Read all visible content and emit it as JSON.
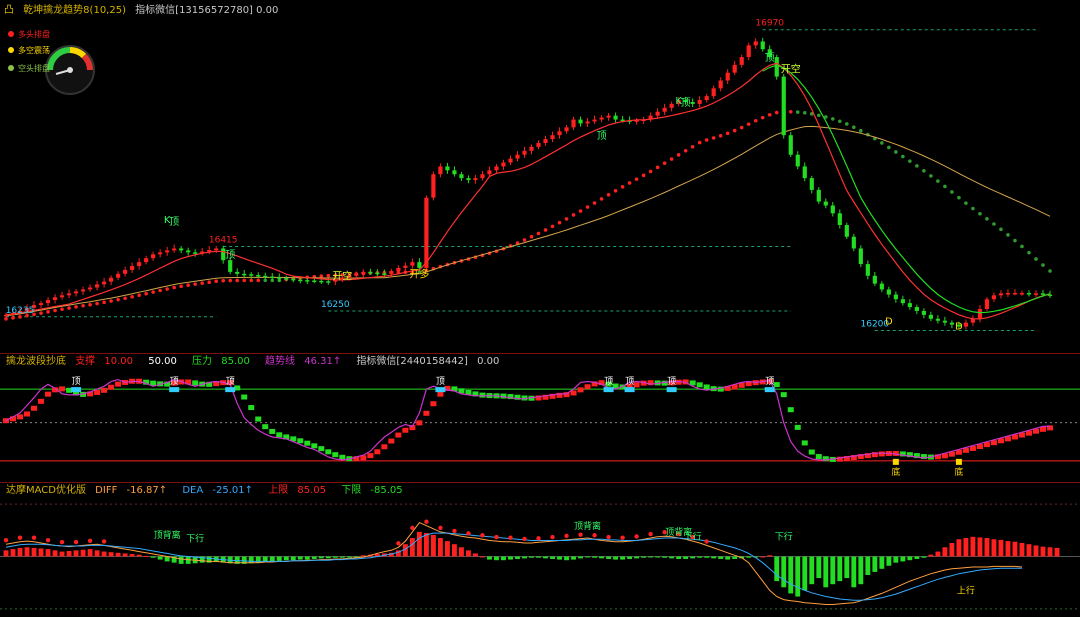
{
  "colors": {
    "up": "#ff2020",
    "down": "#22dd22",
    "bg": "#000000",
    "grid": "#7a1010",
    "gold": "#ffd700",
    "cyan": "#33ccff",
    "magenta": "#cc33cc"
  },
  "main_panel": {
    "header_prefix": "凸",
    "title": "乾坤擒龙趋势8(10,25)",
    "extra_label": "指标微信[13156572780] 0.00",
    "legend": [
      {
        "label": "多头排盘",
        "color": "#ff2020"
      },
      {
        "label": "多空震荡",
        "color": "#ffd700"
      },
      {
        "label": "空头排盘",
        "color": "#8bc34a"
      }
    ],
    "gauge_icon": "speedometer-icon",
    "price_annotations": [
      {
        "text": "16970",
        "x": 109,
        "y": 16970
      },
      {
        "text": "16415",
        "x": 31,
        "y": 16415
      },
      {
        "text": "16250",
        "x": 47,
        "y": 16250
      },
      {
        "text": "16235",
        "x": 2,
        "y": 16235
      },
      {
        "text": "16200",
        "x": 124,
        "y": 16200
      }
    ],
    "signal_labels": [
      {
        "text": "K",
        "x": 23,
        "y": 16475
      },
      {
        "text": "顶",
        "x": 24,
        "y": 16470
      },
      {
        "text": "顶",
        "x": 32,
        "y": 16385
      },
      {
        "text": "开空",
        "x": 48,
        "y": 16330
      },
      {
        "text": "开多",
        "x": 59,
        "y": 16335
      },
      {
        "text": "顶",
        "x": 85,
        "y": 16690
      },
      {
        "text": "K",
        "x": 96,
        "y": 16780
      },
      {
        "text": "顶",
        "x": 97,
        "y": 16775
      },
      {
        "text": "顶",
        "x": 109,
        "y": 16890
      },
      {
        "text": "开空",
        "x": 112,
        "y": 16860
      },
      {
        "text": "D",
        "x": 126,
        "y": 16215
      },
      {
        "text": "D",
        "x": 136,
        "y": 16202
      }
    ]
  },
  "osc_panel": {
    "title": "擒龙波段抄底",
    "items": [
      {
        "label": "支撑",
        "value": "10.00",
        "color": "#ff2020"
      },
      {
        "label": "",
        "value": "50.00",
        "color": "#ffffff"
      },
      {
        "label": "压力",
        "value": "85.00",
        "color": "#22dd22"
      },
      {
        "label": "趋势线",
        "value": "46.31↑",
        "color": "#cc33cc"
      },
      {
        "label": "指标微信[2440158442]",
        "value": "0.00",
        "color": "#cccccc"
      }
    ],
    "top_labels": [
      {
        "text": "顶",
        "x": 10
      },
      {
        "text": "顶",
        "x": 24
      },
      {
        "text": "顶",
        "x": 32
      },
      {
        "text": "顶",
        "x": 62
      },
      {
        "text": "顶",
        "x": 86
      },
      {
        "text": "顶",
        "x": 89
      },
      {
        "text": "顶",
        "x": 95
      },
      {
        "text": "顶",
        "x": 109
      }
    ],
    "bottom_labels": [
      {
        "text": "底",
        "x": 127
      },
      {
        "text": "底",
        "x": 136
      }
    ]
  },
  "macd_panel": {
    "title": "达摩MACD优化版",
    "items": [
      {
        "label": "DIFF",
        "value": "-16.87↑",
        "color": "#ffa040"
      },
      {
        "label": "DEA",
        "value": "-25.01↑",
        "color": "#33aaff"
      },
      {
        "label": "上限",
        "value": "85.05",
        "color": "#ff2020"
      },
      {
        "label": "下限",
        "value": "-85.05",
        "color": "#22dd22"
      }
    ],
    "signal_labels": [
      {
        "text": "顶背离",
        "x": 23,
        "y": 30
      },
      {
        "text": "下行",
        "x": 27,
        "y": 24
      },
      {
        "text": "顶背离",
        "x": 83,
        "y": 45
      },
      {
        "text": "顶背离",
        "x": 96,
        "y": 35
      },
      {
        "text": "下行",
        "x": 98,
        "y": 28
      },
      {
        "text": "下行",
        "x": 111,
        "y": 28
      },
      {
        "text": "上行",
        "x": 137,
        "y": -60
      }
    ]
  },
  "chart_data": {
    "type": "candlestick",
    "x": [
      0,
      1,
      2,
      3,
      4,
      5,
      6,
      7,
      8,
      9,
      10,
      11,
      12,
      13,
      14,
      15,
      16,
      17,
      18,
      19,
      20,
      21,
      22,
      23,
      24,
      25,
      26,
      27,
      28,
      29,
      30,
      31,
      32,
      33,
      34,
      35,
      36,
      37,
      38,
      39,
      40,
      41,
      42,
      43,
      44,
      45,
      46,
      47,
      48,
      49,
      50,
      51,
      52,
      53,
      54,
      55,
      56,
      57,
      58,
      59,
      60,
      61,
      62,
      63,
      64,
      65,
      66,
      67,
      68,
      69,
      70,
      71,
      72,
      73,
      74,
      75,
      76,
      77,
      78,
      79,
      80,
      81,
      82,
      83,
      84,
      85,
      86,
      87,
      88,
      89,
      90,
      91,
      92,
      93,
      94,
      95,
      96,
      97,
      98,
      99,
      100,
      101,
      102,
      103,
      104,
      105,
      106,
      107,
      108,
      109,
      110,
      111,
      112,
      113,
      114,
      115,
      116,
      117,
      118,
      119,
      120,
      121,
      122,
      123,
      124,
      125,
      126,
      127,
      128,
      129,
      130,
      131,
      132,
      133,
      134,
      135,
      136,
      137,
      138,
      139,
      140,
      141,
      142,
      143,
      144,
      145,
      146,
      147,
      148,
      149
    ],
    "close": [
      16240,
      16245,
      16250,
      16258,
      16265,
      16270,
      16278,
      16285,
      16290,
      16295,
      16300,
      16305,
      16310,
      16318,
      16325,
      16335,
      16345,
      16355,
      16365,
      16375,
      16385,
      16395,
      16400,
      16405,
      16410,
      16405,
      16400,
      16398,
      16402,
      16406,
      16410,
      16380,
      16350,
      16345,
      16344,
      16342,
      16340,
      16338,
      16336,
      16334,
      16332,
      16330,
      16329,
      16328,
      16327,
      16326,
      16325,
      16330,
      16335,
      16340,
      16345,
      16350,
      16348,
      16346,
      16345,
      16352,
      16360,
      16366,
      16375,
      16360,
      16540,
      16600,
      16620,
      16610,
      16600,
      16590,
      16585,
      16590,
      16600,
      16610,
      16620,
      16630,
      16640,
      16650,
      16660,
      16670,
      16680,
      16690,
      16700,
      16710,
      16720,
      16740,
      16730,
      16735,
      16740,
      16745,
      16750,
      16740,
      16738,
      16735,
      16738,
      16740,
      16750,
      16760,
      16770,
      16780,
      16790,
      16785,
      16780,
      16790,
      16800,
      16820,
      16840,
      16860,
      16880,
      16900,
      16930,
      16940,
      16920,
      16900,
      16850,
      16700,
      16650,
      16620,
      16590,
      16560,
      16530,
      16520,
      16500,
      16470,
      16440,
      16410,
      16370,
      16340,
      16320,
      16305,
      16292,
      16280,
      16270,
      16260,
      16250,
      16240,
      16230,
      16225,
      16220,
      16215,
      16210,
      16220,
      16230,
      16255,
      16280,
      16290,
      16295,
      16296,
      16296,
      16296,
      16295,
      16295,
      16292,
      16290
    ],
    "ylim": [
      16150,
      17000
    ],
    "osc": {
      "ylim": [
        -10,
        105
      ],
      "support": 10,
      "mid": 50,
      "pressure": 85,
      "trend": [
        52,
        56,
        60,
        68,
        76,
        85,
        90,
        86,
        80,
        79,
        79,
        80,
        82,
        85,
        88,
        93,
        95,
        92,
        93,
        93,
        91,
        88,
        90,
        92,
        95,
        93,
        90,
        88,
        90,
        92,
        93,
        92,
        90,
        70,
        55,
        48,
        42,
        38,
        35,
        34,
        33,
        30,
        27,
        24,
        22,
        18,
        14,
        12,
        11,
        12,
        14,
        16,
        20,
        28,
        35,
        40,
        45,
        48,
        46,
        60,
        85,
        88,
        86,
        84,
        83,
        80,
        79,
        78,
        78,
        78,
        78,
        77,
        76,
        75,
        75,
        76,
        77,
        78,
        79,
        80,
        80,
        85,
        92,
        93,
        92,
        90,
        86,
        85,
        88,
        92,
        93,
        92,
        90,
        91,
        92,
        93,
        93,
        92,
        88,
        85,
        84,
        85,
        86,
        88,
        90,
        92,
        93,
        92,
        93,
        94,
        80,
        50,
        30,
        20,
        15,
        12,
        11,
        11,
        12,
        13,
        14,
        15,
        16,
        17,
        18,
        18,
        18,
        17,
        16,
        15,
        14,
        13,
        14,
        16,
        18,
        20,
        22,
        24,
        26,
        28,
        30,
        32,
        34,
        36,
        38,
        40,
        42,
        44,
        46,
        46
      ]
    },
    "macd": {
      "ylim": [
        -95,
        95
      ],
      "upper": 85.05,
      "lower": -85.05,
      "hist": [
        10,
        12,
        14,
        15,
        14,
        13,
        12,
        10,
        8,
        9,
        10,
        11,
        12,
        10,
        8,
        7,
        6,
        5,
        4,
        3,
        1,
        -2,
        -5,
        -8,
        -10,
        -12,
        -12,
        -11,
        -10,
        -10,
        -9,
        -10,
        -11,
        -12,
        -12,
        -11,
        -10,
        -9,
        -8,
        -7,
        -6,
        -6,
        -5,
        -5,
        -4,
        -3,
        -3,
        -2,
        -2,
        -1,
        -1,
        2,
        3,
        4,
        5,
        6,
        10,
        20,
        30,
        40,
        38,
        35,
        30,
        25,
        20,
        15,
        10,
        5,
        0,
        -5,
        -6,
        -6,
        -5,
        -4,
        -3,
        -2,
        -2,
        -3,
        -4,
        -5,
        -6,
        -5,
        -3,
        -1,
        -2,
        -3,
        -4,
        -5,
        -5,
        -4,
        -3,
        -2,
        -1,
        -1,
        -2,
        -3,
        -4,
        -4,
        -3,
        -2,
        -2,
        -3,
        -4,
        -5,
        -4,
        -3,
        -2,
        -1,
        0,
        2,
        -40,
        -50,
        -60,
        -65,
        -55,
        -45,
        -35,
        -50,
        -45,
        -40,
        -35,
        -50,
        -45,
        -30,
        -25,
        -20,
        -15,
        -10,
        -8,
        -6,
        -4,
        -2,
        3,
        8,
        15,
        22,
        28,
        30,
        32,
        31,
        30,
        28,
        27,
        25,
        24,
        22,
        20,
        18,
        16,
        15,
        14
      ],
      "diff": [
        20,
        22,
        24,
        25,
        24,
        22,
        20,
        18,
        17,
        16,
        17,
        18,
        19,
        20,
        18,
        16,
        14,
        12,
        10,
        8,
        6,
        4,
        2,
        0,
        -2,
        -4,
        -5,
        -6,
        -7,
        -8,
        -8,
        -9,
        -10,
        -10,
        -10,
        -10,
        -10,
        -9,
        -9,
        -8,
        -8,
        -7,
        -7,
        -6,
        -6,
        -5,
        -5,
        -4,
        -4,
        -3,
        -2,
        -1,
        2,
        5,
        8,
        10,
        15,
        25,
        40,
        55,
        50,
        45,
        40,
        38,
        35,
        33,
        31,
        30,
        28,
        26,
        25,
        24,
        24,
        23,
        22,
        22,
        23,
        24,
        25,
        26,
        27,
        28,
        29,
        30,
        28,
        26,
        25,
        24,
        24,
        25,
        26,
        28,
        30,
        32,
        33,
        32,
        30,
        28,
        25,
        22,
        18,
        14,
        10,
        6,
        2,
        -2,
        -10,
        -25,
        -40,
        -55,
        -65,
        -70,
        -72,
        -73,
        -75,
        -76,
        -77,
        -78,
        -78,
        -77,
        -76,
        -75,
        -72,
        -68,
        -64,
        -60,
        -55,
        -50,
        -45,
        -40,
        -36,
        -32,
        -28,
        -25,
        -22,
        -20,
        -19,
        -18,
        -17,
        -17,
        -17,
        -16,
        -16,
        -16,
        -16,
        -17
      ],
      "dea": [
        15,
        17,
        19,
        20,
        20,
        20,
        19,
        18,
        17,
        17,
        17,
        17,
        18,
        18,
        18,
        17,
        16,
        15,
        14,
        13,
        11,
        9,
        7,
        5,
        3,
        1,
        0,
        -1,
        -2,
        -3,
        -4,
        -5,
        -6,
        -7,
        -7,
        -8,
        -8,
        -8,
        -8,
        -8,
        -8,
        -7,
        -7,
        -7,
        -6,
        -6,
        -6,
        -5,
        -5,
        -4,
        -4,
        -3,
        -2,
        0,
        2,
        4,
        7,
        12,
        20,
        30,
        35,
        38,
        38,
        38,
        37,
        36,
        35,
        34,
        33,
        32,
        31,
        30,
        29,
        28,
        27,
        26,
        26,
        26,
        26,
        26,
        26,
        27,
        27,
        28,
        28,
        28,
        27,
        27,
        26,
        26,
        26,
        27,
        28,
        29,
        30,
        30,
        30,
        29,
        28,
        27,
        25,
        23,
        20,
        17,
        14,
        10,
        5,
        -2,
        -10,
        -20,
        -30,
        -38,
        -45,
        -50,
        -55,
        -59,
        -62,
        -65,
        -67,
        -69,
        -70,
        -71,
        -71,
        -70,
        -69,
        -67,
        -64,
        -61,
        -57,
        -53,
        -49,
        -45,
        -41,
        -37,
        -34,
        -31,
        -28,
        -26,
        -24,
        -22,
        -21,
        -20,
        -19,
        -19,
        -19,
        -19
      ]
    }
  }
}
